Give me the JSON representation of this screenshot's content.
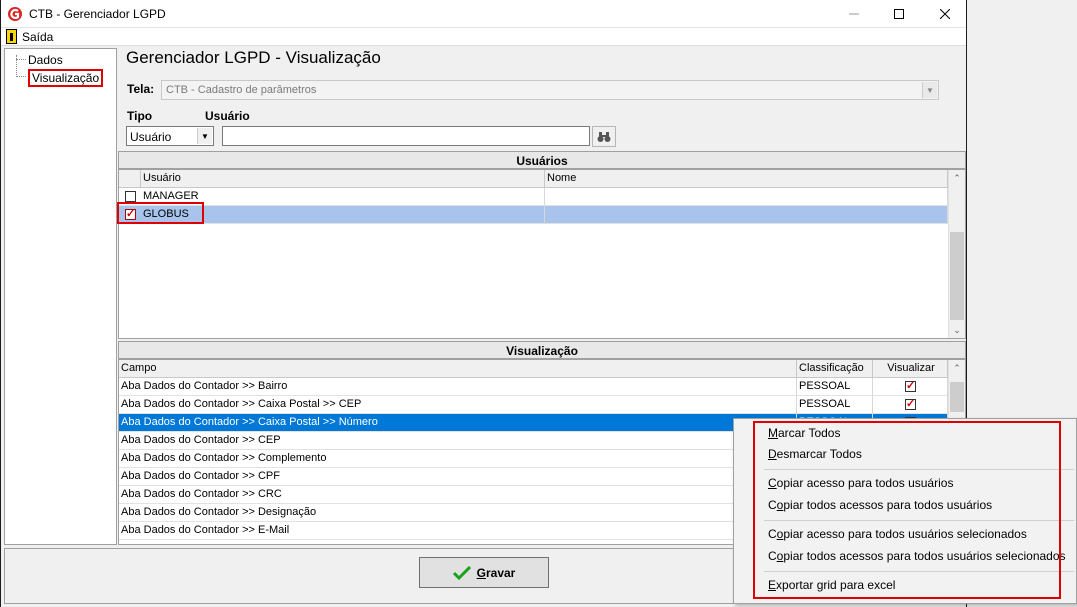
{
  "window": {
    "title": "CTB - Gerenciador LGPD"
  },
  "menubar": {
    "exit_label": "Saída"
  },
  "tree": {
    "items": [
      "Dados",
      "Visualização"
    ]
  },
  "form": {
    "page_title": "Gerenciador LGPD - Visualização",
    "tela_label": "Tela:",
    "tela_value": "CTB - Cadastro de parâmetros",
    "tipo_label": "Tipo",
    "tipo_value": "Usuário",
    "usuario_label": "Usuário",
    "usuario_value": ""
  },
  "usuarios_grid": {
    "title": "Usuários",
    "columns": [
      "Usuário",
      "Nome"
    ],
    "rows": [
      {
        "usuario": "MANAGER",
        "nome": "",
        "checked": false,
        "selected": false
      },
      {
        "usuario": "GLOBUS",
        "nome": "",
        "checked": true,
        "selected": true
      }
    ]
  },
  "visualizacao_grid": {
    "title": "Visualização",
    "columns": [
      "Campo",
      "Classificação",
      "Visualizar"
    ],
    "rows": [
      {
        "campo": "Aba Dados do Contador >> Bairro",
        "classificacao": "PESSOAL",
        "visualizar": true
      },
      {
        "campo": "Aba Dados do Contador >> Caixa Postal >> CEP",
        "classificacao": "PESSOAL",
        "visualizar": true
      },
      {
        "campo": "Aba Dados do Contador >> Caixa Postal >> Número",
        "classificacao": "PESSOAL",
        "visualizar": true,
        "selected": true
      },
      {
        "campo": "Aba Dados do Contador >> CEP",
        "classificacao": "",
        "visualizar": null
      },
      {
        "campo": "Aba Dados do Contador >> Complemento",
        "classificacao": "",
        "visualizar": null
      },
      {
        "campo": "Aba Dados do Contador >> CPF",
        "classificacao": "",
        "visualizar": null
      },
      {
        "campo": "Aba Dados do Contador >> CRC",
        "classificacao": "",
        "visualizar": null
      },
      {
        "campo": "Aba Dados do Contador >> Designação",
        "classificacao": "",
        "visualizar": null
      },
      {
        "campo": "Aba Dados do Contador >> E-Mail",
        "classificacao": "",
        "visualizar": null
      }
    ]
  },
  "footer": {
    "gravar_label": "Gravar"
  },
  "context_menu": {
    "groups": [
      [
        "Marcar Todos",
        "Desmarcar Todos"
      ],
      [
        "Copiar acesso para todos usuários",
        "Copiar todos acessos para todos usuários"
      ],
      [
        "Copiar acesso para todos usuários selecionados",
        "Copiar todos acessos para todos usuários selecionados"
      ],
      [
        "Exportar grid para excel"
      ]
    ],
    "mnemonics": [
      "M",
      "D",
      "C",
      "o",
      "o",
      "o",
      "E"
    ]
  },
  "colors": {
    "selection_blue": "#0078d7",
    "row_highlight": "#a8c4ec",
    "annotation_red": "#e00000",
    "check_red": "#d00000",
    "gravar_check_green": "#1aa31a"
  }
}
